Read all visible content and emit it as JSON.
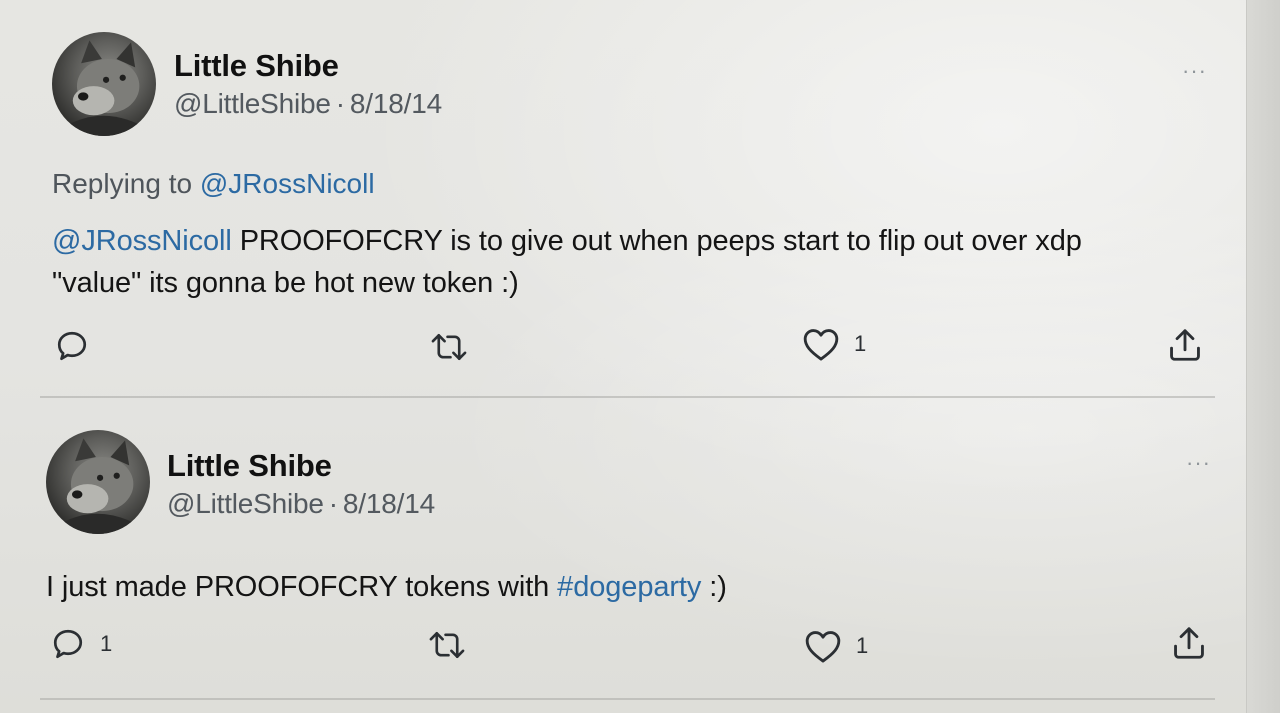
{
  "tweets": [
    {
      "author": {
        "name": "Little Shibe",
        "handle": "@LittleShibe",
        "date": "8/18/14"
      },
      "more_icon": "more-horizontal-icon",
      "replying_prefix": "Replying to",
      "replying_to": "@JRossNicoll",
      "mention": "@JRossNicoll",
      "text_line1": "PROOFOFCRY is to give out when peeps start to flip out over xdp",
      "text_line2": "\"value\" its gonna be hot new token :)",
      "actions": {
        "reply": {
          "icon": "reply-icon",
          "count": ""
        },
        "retweet": {
          "icon": "retweet-icon",
          "count": ""
        },
        "like": {
          "icon": "heart-icon",
          "count": "1"
        },
        "share": {
          "icon": "share-icon",
          "count": ""
        }
      }
    },
    {
      "author": {
        "name": "Little Shibe",
        "handle": "@LittleShibe",
        "date": "8/18/14"
      },
      "more_icon": "more-horizontal-icon",
      "text_before": "I just made PROOFOFCRY tokens with",
      "hashtag": "#dogeparty",
      "text_after": ":)",
      "actions": {
        "reply": {
          "icon": "reply-icon",
          "count": "1"
        },
        "retweet": {
          "icon": "retweet-icon",
          "count": ""
        },
        "like": {
          "icon": "heart-icon",
          "count": "1"
        },
        "share": {
          "icon": "share-icon",
          "count": ""
        }
      }
    }
  ],
  "separator": "·",
  "colors": {
    "link": "#2c6aa3",
    "text": "#141414",
    "muted": "#53595f"
  }
}
